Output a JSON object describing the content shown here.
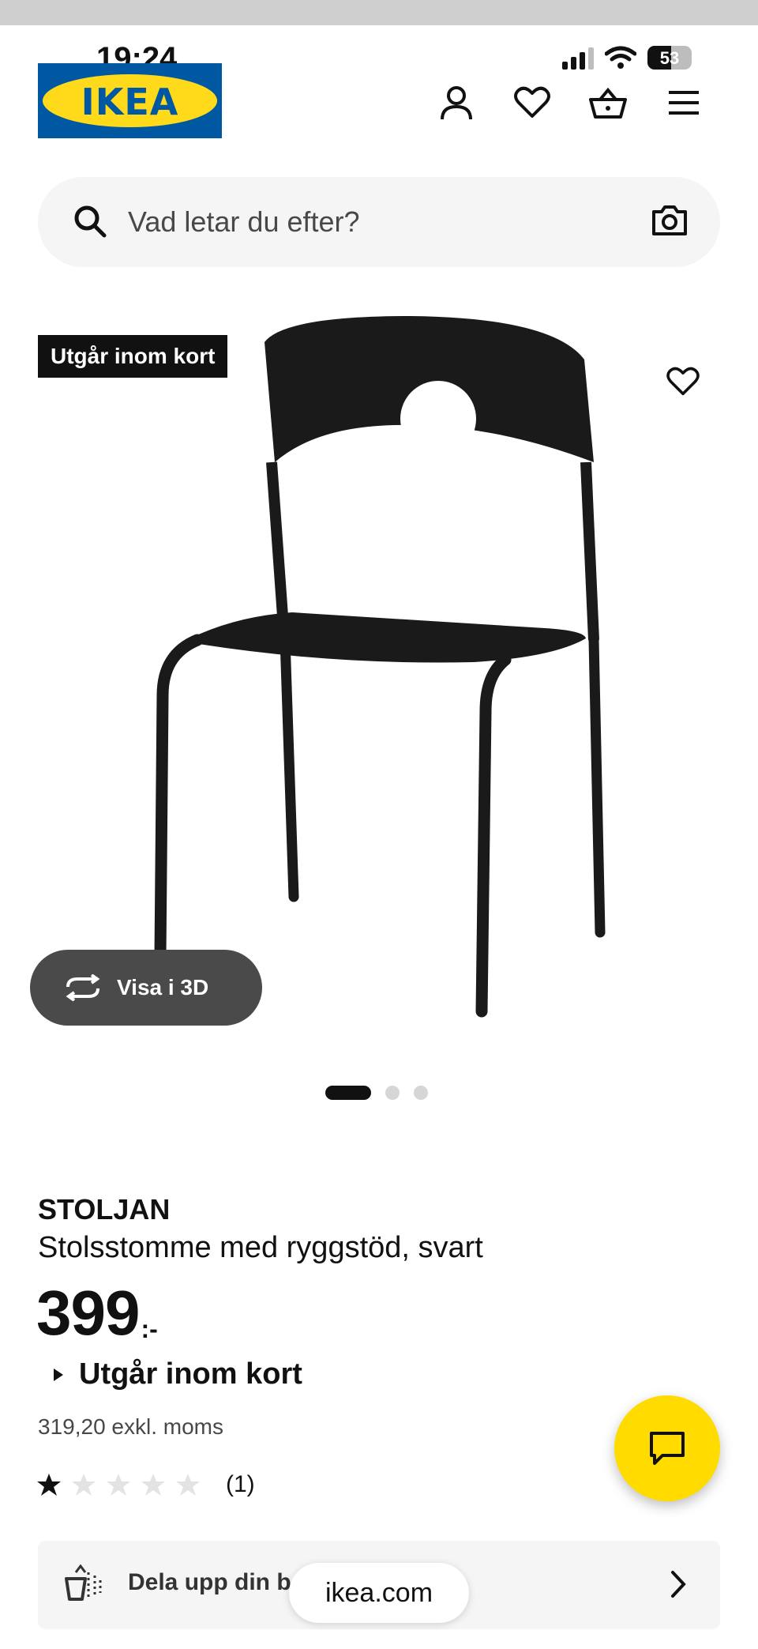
{
  "status_bar": {
    "time": "19:24",
    "battery": "53",
    "battery_level": 0.53
  },
  "header": {
    "logo_text": "IKEA",
    "icons": [
      "profile-icon",
      "heart-icon",
      "basket-icon",
      "menu-icon"
    ]
  },
  "search": {
    "placeholder": "Vad letar du efter?",
    "icons": [
      "search-icon",
      "camera-icon"
    ]
  },
  "gallery": {
    "badge": "Utgår inom kort",
    "view_3d_label": "Visa i 3D",
    "slide_count": 3,
    "active_slide": 1
  },
  "product": {
    "name": "STOLJAN",
    "description": "Stolsstomme med ryggstöd, svart",
    "price": "399",
    "price_suffix": ":-",
    "availability": "Utgår inom kort",
    "price_excl_vat": "319,20 exkl. moms",
    "rating_stars": 1,
    "rating_max": 5,
    "review_count": "(1)"
  },
  "promo": {
    "text": "Dela upp din b"
  },
  "browser": {
    "url": "ikea.com"
  },
  "colors": {
    "ikea_blue": "#0058a3",
    "ikea_yellow": "#ffda1a",
    "chat_yellow": "#ffdb00",
    "dark_button": "#4a4a4a"
  }
}
